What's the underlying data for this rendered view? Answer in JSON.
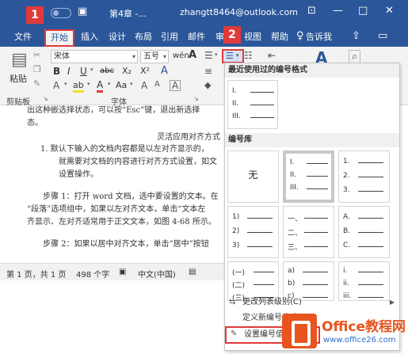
{
  "titlebar": {
    "save_icon": "save-icon",
    "doc_title": "第4章 -...",
    "user": "zhangtt8464@outlook.com",
    "controls": [
      "restore-ribbon-icon",
      "minimize-icon",
      "maximize-icon",
      "close-icon"
    ]
  },
  "tabs": [
    {
      "label": "文件"
    },
    {
      "label": "开始",
      "active": true
    },
    {
      "label": "插入"
    },
    {
      "label": "设计"
    },
    {
      "label": "布局"
    },
    {
      "label": "引用"
    },
    {
      "label": "邮件"
    },
    {
      "label": "审"
    },
    {
      "label": "视图"
    },
    {
      "label": "帮助"
    },
    {
      "label": "告诉我"
    }
  ],
  "callouts": {
    "one": "1",
    "two": "2"
  },
  "ribbon": {
    "paste_label": "粘贴",
    "clipboard_label": "剪贴板",
    "font_group_label": "字体",
    "font_name": "宋体",
    "font_size": "五号",
    "font_glyph_w": "wén",
    "aa_label": "A",
    "bold": "B",
    "italic": "I",
    "underline": "U",
    "strike": "abc",
    "subscript": "X₂",
    "superscript": "X²",
    "font_color": "A",
    "highlight": "ab",
    "grow_shrink": "Aa",
    "accent_colors": {
      "highlight": "#f2e21b",
      "font": "#e03a3a"
    }
  },
  "document": {
    "lines": [
      "出这种嵌选择状态，可以按“Esc”键，退出新选择",
      "态。",
      "灵活应用对齐方式",
      "1.  默认下输入的文档内容都是以左对齐显示的，",
      "就需要对文档的内容进行对齐方式设置，如文",
      "设置操作。",
      "步骤 1：打开 word 文档，选中要设置的文本。在",
      "“段落”选项组中，如果以左对齐文本，单击“文本左",
      "齐显示、左对齐适常用于正文文本，如图 4-68 所示。",
      "步骤 2：如果以居中对齐文本，单击“居中”按钮"
    ]
  },
  "status": {
    "page": "第 1 页，共 1 页",
    "words": "498 个字",
    "lang": "中文(中国)"
  },
  "panel": {
    "recent_header": "最近使用过的编号格式",
    "recent_tile": {
      "lines": [
        "I.",
        "II.",
        "III."
      ]
    },
    "library_header": "编号库",
    "tiles": [
      {
        "none": "无"
      },
      {
        "lines": [
          "I.",
          "II.",
          "III."
        ],
        "selected": true
      },
      {
        "lines": [
          "1.",
          "2.",
          "3."
        ]
      },
      {
        "lines": [
          "1)",
          "2)",
          "3)"
        ]
      },
      {
        "lines": [
          "一、",
          "二、",
          "三、"
        ]
      },
      {
        "lines": [
          "A.",
          "B.",
          "C."
        ]
      },
      {
        "lines": [
          "(一)",
          "(二)",
          "(三)"
        ]
      },
      {
        "lines": [
          "a)",
          "b)",
          "c)"
        ]
      },
      {
        "lines": [
          "i.",
          "ii.",
          "iii."
        ]
      }
    ],
    "menu": [
      {
        "label": "更改列表级别(C)",
        "icon": "list-level-icon",
        "submenu": true
      },
      {
        "label": "定义新编号格式(D)...",
        "icon": ""
      },
      {
        "label": "设置编号值(V)...",
        "icon": "set-value-icon"
      }
    ]
  },
  "watermark": {
    "title": "Office教程网",
    "url": "www.office26.com"
  }
}
